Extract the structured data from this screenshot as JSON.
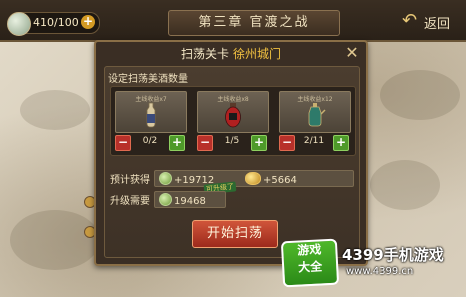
{
  "header": {
    "stamina": "410/100",
    "chapter_title": "第三章 官渡之战",
    "back_label": "返回"
  },
  "dialog": {
    "title": "扫荡关卡",
    "city": "徐州城门",
    "section_label": "设定扫荡美酒数量",
    "slots": [
      {
        "caption": "主线收益x7",
        "count": "0/2",
        "bottle": "vase",
        "color": "#3a4a7a"
      },
      {
        "caption": "主线收益x8",
        "count": "1/5",
        "bottle": "urn",
        "color": "#b02020"
      },
      {
        "caption": "主线收益x12",
        "count": "2/11",
        "bottle": "teapot",
        "color": "#2e7a6a"
      }
    ],
    "expected_label": "预计获得",
    "expected_exp": "+19712",
    "expected_gold": "+5664",
    "hint": "可升级了",
    "upgrade_label": "升级需要",
    "upgrade_value": "19468",
    "start_button": "开始扫荡"
  },
  "watermark": {
    "logo_line1": "游戏",
    "logo_line2": "大全",
    "site": "4399手机游戏",
    "url": "www.4399.cn"
  }
}
